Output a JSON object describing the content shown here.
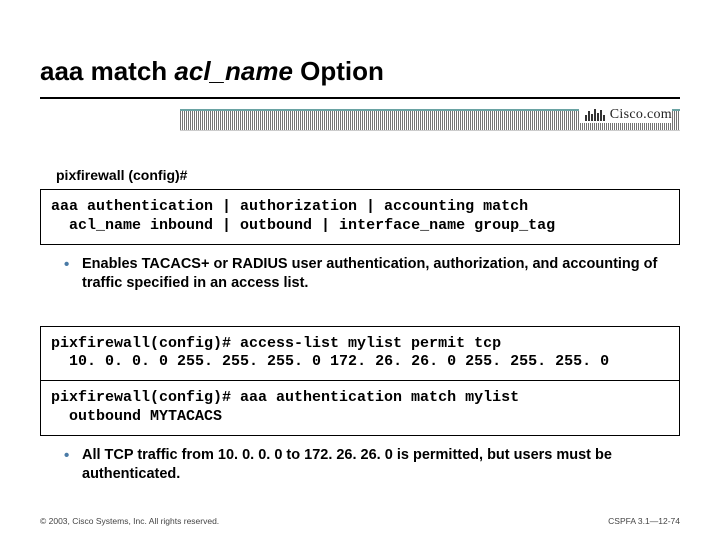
{
  "title": {
    "part1": "aaa match ",
    "part2_italic": "acl_name",
    "part3": " Option"
  },
  "logo_text": "Cisco.com",
  "prompt1": "pixfirewall (config)#",
  "code1": "aaa authentication | authorization | accounting match \n  acl_name inbound | outbound | interface_name group_tag",
  "bullet1": "Enables TACACS+ or RADIUS user authentication, authorization, and accounting of traffic specified in an access list.",
  "code2": "pixfirewall(config)# access-list mylist permit tcp \n  10. 0. 0. 0 255. 255. 255. 0 172. 26. 26. 0 255. 255. 255. 0",
  "code3": "pixfirewall(config)# aaa authentication match mylist \n  outbound MYTACACS",
  "bullet2": "All TCP traffic from 10. 0. 0. 0 to 172. 26. 26. 0 is permitted, but users must be authenticated.",
  "footer_left": "© 2003, Cisco Systems, Inc. All rights reserved.",
  "footer_right": "CSPFA 3.1—12-74"
}
